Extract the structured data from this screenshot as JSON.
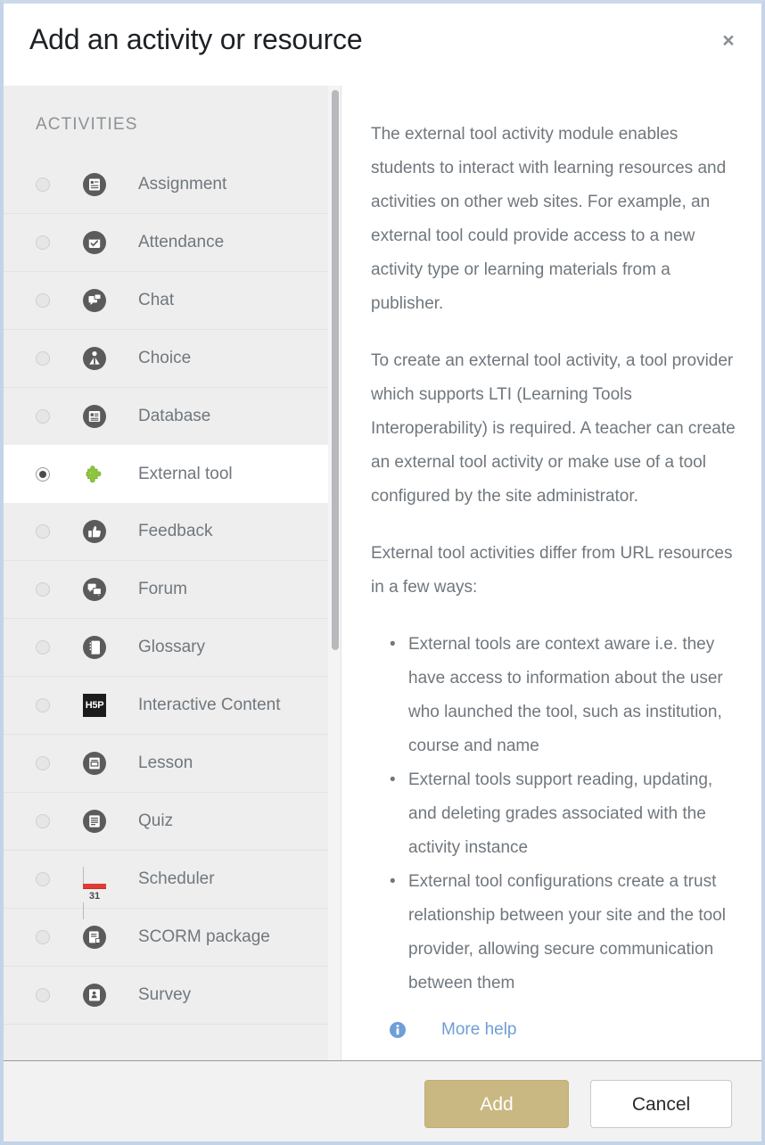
{
  "dialog": {
    "title": "Add an activity or resource",
    "close_label": "×",
    "close_icon": "close-icon"
  },
  "sidebar": {
    "section_label": "ACTIVITIES",
    "items": [
      {
        "label": "Assignment",
        "icon": "assignment-icon",
        "selected": false
      },
      {
        "label": "Attendance",
        "icon": "attendance-icon",
        "selected": false
      },
      {
        "label": "Chat",
        "icon": "chat-icon",
        "selected": false
      },
      {
        "label": "Choice",
        "icon": "choice-icon",
        "selected": false
      },
      {
        "label": "Database",
        "icon": "database-icon",
        "selected": false
      },
      {
        "label": "External tool",
        "icon": "puzzle-piece-icon",
        "selected": true
      },
      {
        "label": "Feedback",
        "icon": "thumbs-up-icon",
        "selected": false
      },
      {
        "label": "Forum",
        "icon": "forum-icon",
        "selected": false
      },
      {
        "label": "Glossary",
        "icon": "glossary-icon",
        "selected": false
      },
      {
        "label": "Interactive Content",
        "icon": "h5p-icon",
        "selected": false,
        "icon_text": "H5P"
      },
      {
        "label": "Lesson",
        "icon": "lesson-icon",
        "selected": false
      },
      {
        "label": "Quiz",
        "icon": "quiz-icon",
        "selected": false
      },
      {
        "label": "Scheduler",
        "icon": "calendar-icon",
        "selected": false,
        "icon_text": "31"
      },
      {
        "label": "SCORM package",
        "icon": "scorm-icon",
        "selected": false
      },
      {
        "label": "Survey",
        "icon": "survey-icon",
        "selected": false
      }
    ]
  },
  "detail": {
    "paragraphs": [
      "The external tool activity module enables students to interact with learning resources and activities on other web sites. For example, an external tool could provide access to a new activity type or learning materials from a publisher.",
      "To create an external tool activity, a tool provider which supports LTI (Learning Tools Interoperability) is required. A teacher can create an external tool activity or make use of a tool configured by the site administrator.",
      "External tool activities differ from URL resources in a few ways:"
    ],
    "bullets": [
      "External tools are context aware i.e. they have access to information about the user who launched the tool, such as institution, course and name",
      "External tools support reading, updating, and deleting grades associated with the activity instance",
      "External tool configurations create a trust relationship between your site and the tool provider, allowing secure communication between them"
    ],
    "more_help_label": "More help",
    "info_icon": "info-circle-icon"
  },
  "footer": {
    "add_label": "Add",
    "cancel_label": "Cancel"
  },
  "colors": {
    "add_button": "#c9b881",
    "link": "#6f9ed8",
    "sidebar_bg": "#eeeeee",
    "text": "#70777d",
    "puzzle_green": "#8cc63f"
  }
}
